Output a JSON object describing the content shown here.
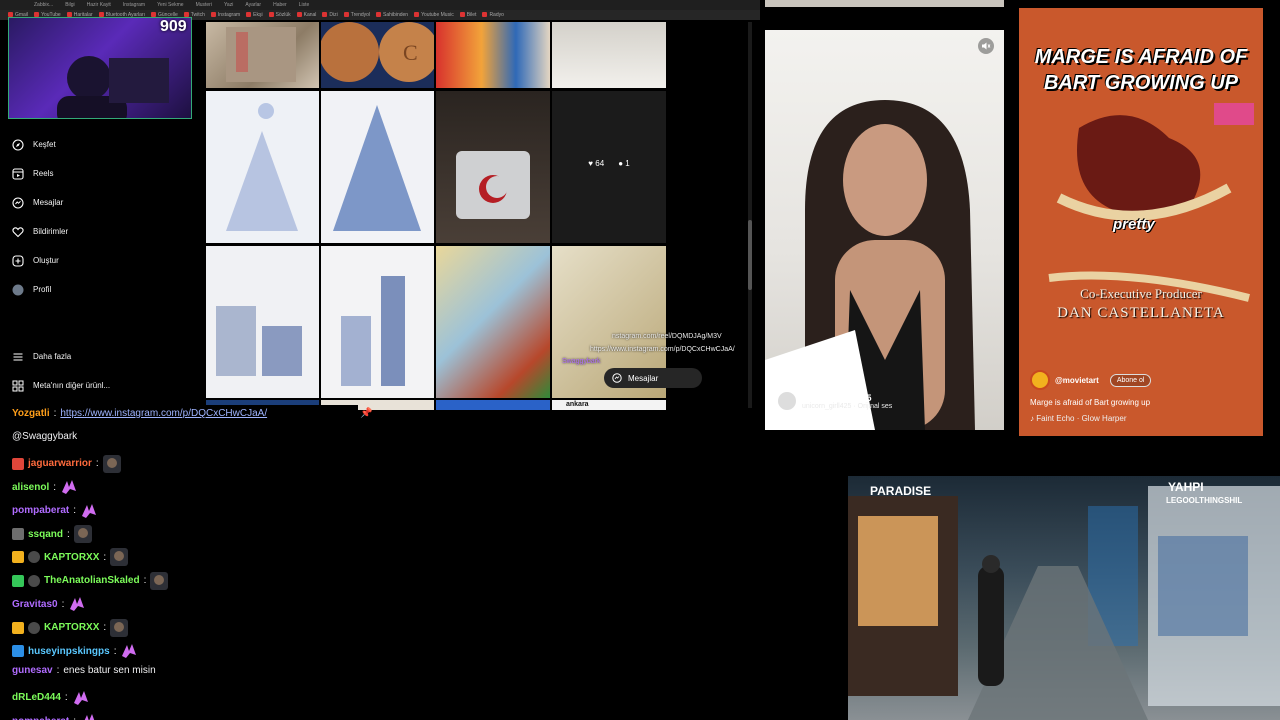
{
  "browser": {
    "url": "instagram.com/...",
    "tabs": [
      "Zabbix...",
      "Bilgi",
      "Hazir Kayit",
      "Instagram",
      "Yeni Sekme",
      "Musteri",
      "Yazi",
      "Ayarlar",
      "Haber",
      "Liste"
    ],
    "bookmarks": [
      "Gmail",
      "YouTube",
      "Haritalar",
      "Bluetooth Ayarları",
      "Güncelle",
      "Twitch",
      "Instagram",
      "Ekşi",
      "Sözlük",
      "Kanal",
      "Dizi",
      "Trendyol",
      "Sahibinden",
      "Youtube Music",
      "Bilet",
      "Radyo"
    ]
  },
  "webcam": {
    "viewer_count": "909"
  },
  "sidebar": {
    "items": [
      {
        "label": "Keşfet",
        "icon": "compass-icon"
      },
      {
        "label": "Reels",
        "icon": "reels-icon"
      },
      {
        "label": "Mesajlar",
        "icon": "messenger-icon"
      },
      {
        "label": "Bildirimler",
        "icon": "heart-icon"
      },
      {
        "label": "Oluştur",
        "icon": "plus-square-icon"
      },
      {
        "label": "Profil",
        "icon": "avatar"
      }
    ],
    "bottom": [
      {
        "label": "Daha fazla",
        "icon": "menu-icon"
      },
      {
        "label": "Meta'nın diğer ürünl...",
        "icon": "meta-apps-icon"
      }
    ]
  },
  "grid": {
    "hover_post": {
      "likes": "64",
      "comments": "1"
    },
    "overlay_links": [
      "nstagram.com/reel/DQMDJAg/M3V",
      "https://www.instagram.com/p/DQCxCHwCJaA/",
      "Swaggybark"
    ],
    "tile_label": "ankara",
    "messages_bar": "Mesajlar"
  },
  "chat": {
    "lines": [
      {
        "user": "Yozgatli",
        "color": "#ff9f1a",
        "msg": "https://www.instagram.com/p/DQCxCHwCJaA/",
        "link": true
      },
      {
        "user": "",
        "color": "#efeff1",
        "msg": "@Swaggybark",
        "link": false
      },
      {
        "user": "jaguarwarrior",
        "color": "#ff6b3d",
        "msg": "",
        "emote": "face-emote",
        "badge": "red"
      },
      {
        "user": "alisenol",
        "color": "#7cfc5a",
        "msg": "",
        "emote": "pink-emote"
      },
      {
        "user": "pompaberat",
        "color": "#b06cff",
        "msg": "",
        "emote": "pink-emote"
      },
      {
        "user": "ssqand",
        "color": "#7cfc5a",
        "msg": "",
        "emote": "face-emote",
        "badge": "grey"
      },
      {
        "user": "KAPTORXX",
        "color": "#7cfc5a",
        "msg": "",
        "emote": "face-emote",
        "badge": "crown"
      },
      {
        "user": "TheAnatolianSkaled",
        "color": "#7cfc5a",
        "msg": "",
        "emote": "face-emote",
        "badge": "gift"
      },
      {
        "user": "Gravitas0",
        "color": "#b06cff",
        "msg": "",
        "emote": "pink-emote"
      },
      {
        "user": "KAPTORXX",
        "color": "#7cfc5a",
        "msg": "",
        "emote": "face-emote",
        "badge": "crown"
      },
      {
        "user": "huseyinpskingps",
        "color": "#5ac8ff",
        "msg": "",
        "emote": "pink-emote",
        "badge": "blue"
      },
      {
        "user": "gunesav",
        "color": "#b06cff",
        "msg": "enes batur sen misin",
        "link": false
      },
      {
        "user": "dRLeD444",
        "color": "#7cfc5a",
        "msg": "",
        "emote": "pink-emote"
      },
      {
        "user": "pompaberat",
        "color": "#b06cff",
        "msg": "",
        "emote": "pink-emote"
      }
    ]
  },
  "reel1": {
    "username": "unicorn_girll425",
    "audio": "unicorn_girll425 · Orijinal ses"
  },
  "reel2": {
    "title": "MARGE IS AFRAID OF BART GROWING UP",
    "caption": "pretty",
    "credit_role": "Co-Executive Producer",
    "credit_name": "DAN CASTELLANETA",
    "username": "@movietart",
    "follow_label": "Abone ol",
    "description": "Marge is afraid of Bart growing up",
    "audio": "Faint Echo · Glow Harper"
  },
  "street": {
    "signs": [
      "PARADISE",
      "YAHPI",
      "LEGOOLTHINGSHIL"
    ]
  },
  "colors": {
    "bg": "#000000",
    "accent_green": "#33aa77",
    "link": "#9fb4ff"
  }
}
